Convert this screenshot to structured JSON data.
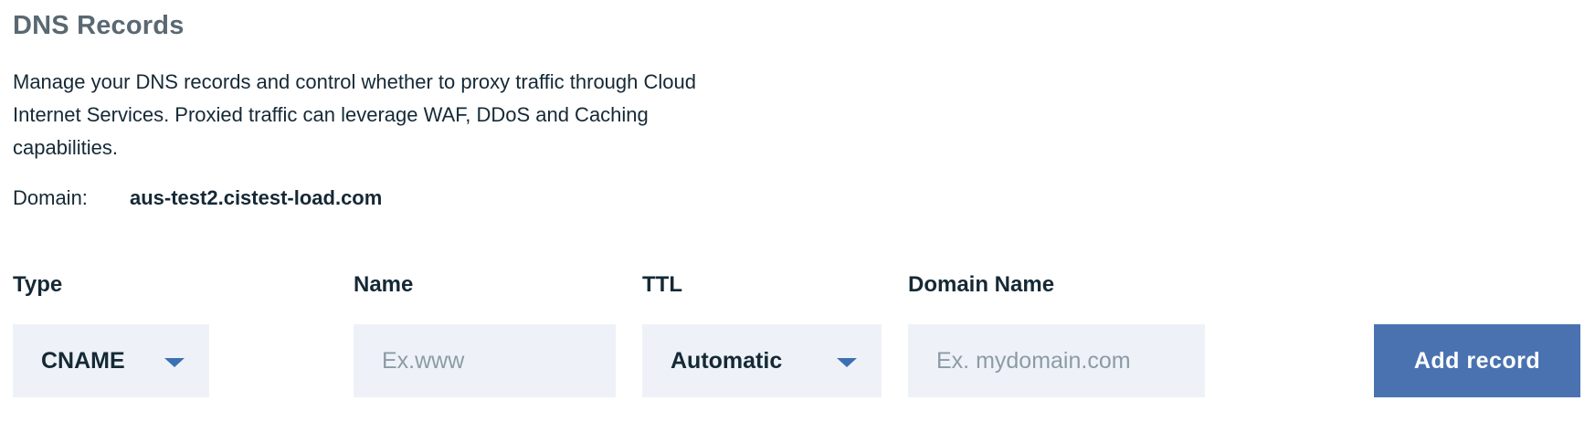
{
  "header": {
    "title": "DNS Records",
    "description": "Manage your DNS records and control whether to proxy traffic through Cloud Internet Services. Proxied traffic can leverage WAF, DDoS and Caching capabilities."
  },
  "domain": {
    "label": "Domain:",
    "value": "aus-test2.cistest-load.com"
  },
  "form": {
    "type": {
      "label": "Type",
      "selected": "CNAME",
      "icon": "chevron-down-icon"
    },
    "name": {
      "label": "Name",
      "placeholder": "Ex.www",
      "value": ""
    },
    "ttl": {
      "label": "TTL",
      "selected": "Automatic",
      "icon": "chevron-down-icon"
    },
    "domain_name": {
      "label": "Domain Name",
      "placeholder": "Ex. mydomain.com",
      "value": ""
    },
    "submit_label": "Add record"
  },
  "colors": {
    "title": "#5a6872",
    "text": "#152935",
    "field_background": "#eef2f8",
    "caret": "#3d70b2",
    "primary_button": "#4a72b0",
    "placeholder": "#8c9ba5"
  }
}
